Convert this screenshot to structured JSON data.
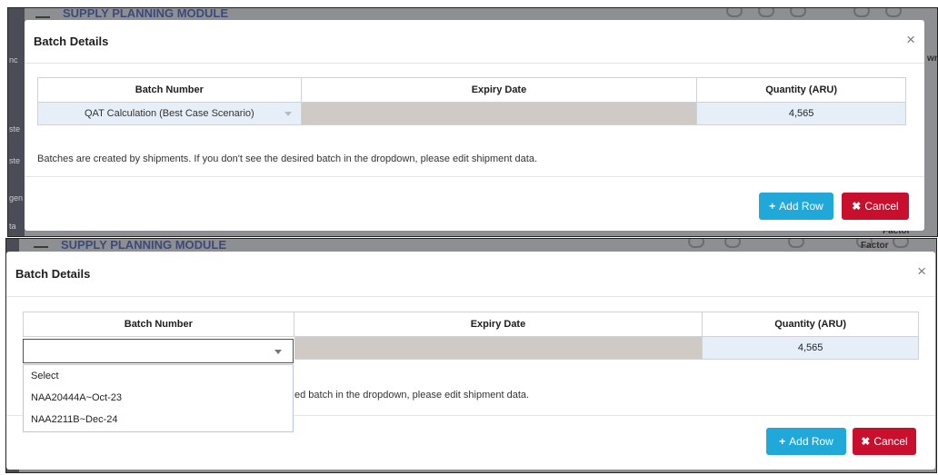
{
  "background": {
    "module_title": "SUPPLY PLANNING MODULE",
    "top_left_fragment": "nc",
    "right_fragment": "wnl",
    "left_fragments": [
      "ste",
      "ste",
      "gen",
      "ta"
    ],
    "factor": "Factor"
  },
  "modal": {
    "title": "Batch Details",
    "close": "×"
  },
  "table": {
    "headers": [
      "Batch Number",
      "Expiry Date",
      "Quantity (ARU)"
    ]
  },
  "row_top": {
    "batch": "QAT Calculation (Best Case Scenario)",
    "expiry": "",
    "quantity": "4,565"
  },
  "row_bottom": {
    "batch": "",
    "expiry": "",
    "quantity": "4,565"
  },
  "note_full": "Batches are created by shipments. If you don't see the desired batch in the dropdown, please edit shipment data.",
  "note_partial": "ed batch in the dropdown, please edit shipment data.",
  "buttons": {
    "add_icon": "+",
    "add_label": "Add Row",
    "cancel_icon": "✖",
    "cancel_label": "Cancel"
  },
  "dropdown_options": [
    "Select",
    "NAA20444A~Oct-23",
    "NAA2211B~Dec-24"
  ],
  "colors": {
    "add_button": "#20a8d8",
    "cancel_button": "#c8102e",
    "expiry_cell": "#cfcac6",
    "quantity_cell": "#e6eef7"
  }
}
